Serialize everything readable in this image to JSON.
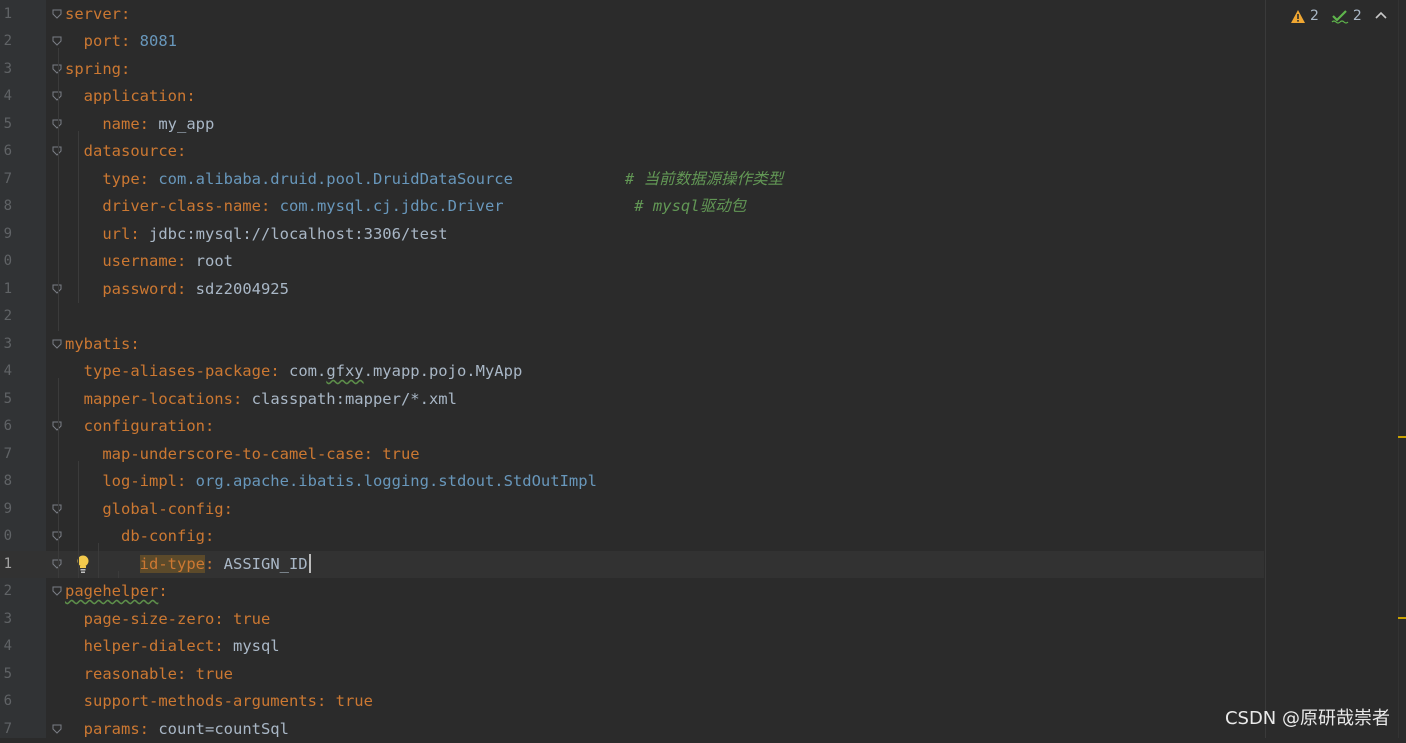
{
  "editor": {
    "lines": [
      {
        "n": "1",
        "tokens": [
          {
            "t": "server",
            "c": "key"
          },
          {
            "t": ":",
            "c": "punct"
          }
        ]
      },
      {
        "n": "2",
        "tokens": [
          {
            "t": "  port",
            "c": "key"
          },
          {
            "t": ": ",
            "c": "punct"
          },
          {
            "t": "8081",
            "c": "vals"
          }
        ]
      },
      {
        "n": "3",
        "tokens": [
          {
            "t": "spring",
            "c": "key"
          },
          {
            "t": ":",
            "c": "punct"
          }
        ]
      },
      {
        "n": "4",
        "tokens": [
          {
            "t": "  application",
            "c": "key"
          },
          {
            "t": ":",
            "c": "punct"
          }
        ]
      },
      {
        "n": "5",
        "tokens": [
          {
            "t": "    name",
            "c": "key"
          },
          {
            "t": ": ",
            "c": "punct"
          },
          {
            "t": "my_app",
            "c": "val"
          }
        ]
      },
      {
        "n": "6",
        "tokens": [
          {
            "t": "  datasource",
            "c": "key"
          },
          {
            "t": ":",
            "c": "punct"
          }
        ]
      },
      {
        "n": "7",
        "tokens": [
          {
            "t": "    type",
            "c": "key"
          },
          {
            "t": ": ",
            "c": "punct"
          },
          {
            "t": "com.alibaba.druid.pool.DruidDataSource",
            "c": "vals"
          },
          {
            "t": "            # 当前数据源操作类型",
            "c": "cmt"
          }
        ]
      },
      {
        "n": "8",
        "tokens": [
          {
            "t": "    driver-class-name",
            "c": "key"
          },
          {
            "t": ": ",
            "c": "punct"
          },
          {
            "t": "com.mysql.cj.jdbc.Driver",
            "c": "vals"
          },
          {
            "t": "              # mysql驱动包",
            "c": "cmt"
          }
        ]
      },
      {
        "n": "9",
        "tokens": [
          {
            "t": "    url",
            "c": "key"
          },
          {
            "t": ": ",
            "c": "punct"
          },
          {
            "t": "jdbc:mysql://localhost:3306/test",
            "c": "val"
          }
        ]
      },
      {
        "n": "0",
        "tokens": [
          {
            "t": "    username",
            "c": "key"
          },
          {
            "t": ": ",
            "c": "punct"
          },
          {
            "t": "root",
            "c": "val"
          }
        ]
      },
      {
        "n": "1",
        "tokens": [
          {
            "t": "    password",
            "c": "key"
          },
          {
            "t": ": ",
            "c": "punct"
          },
          {
            "t": "sdz2004925",
            "c": "val"
          }
        ]
      },
      {
        "n": "2",
        "tokens": []
      },
      {
        "n": "3",
        "tokens": [
          {
            "t": "mybatis",
            "c": "key"
          },
          {
            "t": ":",
            "c": "punct"
          }
        ]
      },
      {
        "n": "4",
        "tokens": [
          {
            "t": "  type-aliases-package",
            "c": "key"
          },
          {
            "t": ": ",
            "c": "punct"
          },
          {
            "t": "com.",
            "c": "val"
          },
          {
            "t": "gfxy",
            "c": "val typo"
          },
          {
            "t": ".myapp.pojo.MyApp",
            "c": "val"
          }
        ]
      },
      {
        "n": "5",
        "tokens": [
          {
            "t": "  mapper-locations",
            "c": "key"
          },
          {
            "t": ": ",
            "c": "punct"
          },
          {
            "t": "classpath:mapper/*.xml",
            "c": "val"
          }
        ]
      },
      {
        "n": "6",
        "tokens": [
          {
            "t": "  configuration",
            "c": "key"
          },
          {
            "t": ":",
            "c": "punct"
          }
        ]
      },
      {
        "n": "7",
        "tokens": [
          {
            "t": "    map-underscore-to-camel-case",
            "c": "key"
          },
          {
            "t": ": ",
            "c": "punct"
          },
          {
            "t": "true",
            "c": "bool"
          }
        ]
      },
      {
        "n": "8",
        "tokens": [
          {
            "t": "    log-impl",
            "c": "key"
          },
          {
            "t": ": ",
            "c": "punct"
          },
          {
            "t": "org.apache.ibatis.logging.stdout.StdOutImpl",
            "c": "vals"
          }
        ]
      },
      {
        "n": "9",
        "tokens": [
          {
            "t": "    global-config",
            "c": "key"
          },
          {
            "t": ":",
            "c": "punct"
          }
        ]
      },
      {
        "n": "0",
        "tokens": [
          {
            "t": "      db-config",
            "c": "key"
          },
          {
            "t": ":",
            "c": "punct"
          }
        ]
      },
      {
        "n": "1",
        "tokens": [
          {
            "t": "        ",
            "c": "val"
          },
          {
            "t": "id-type",
            "c": "key hl-key"
          },
          {
            "t": ": ",
            "c": "punct"
          },
          {
            "t": "ASSIGN_ID",
            "c": "val"
          }
        ],
        "current": true
      },
      {
        "n": "2",
        "tokens": [
          {
            "t": "pagehelper",
            "c": "key typo"
          },
          {
            "t": ":",
            "c": "punct"
          }
        ]
      },
      {
        "n": "3",
        "tokens": [
          {
            "t": "  page-size-zero",
            "c": "key"
          },
          {
            "t": ": ",
            "c": "punct"
          },
          {
            "t": "true",
            "c": "bool"
          }
        ]
      },
      {
        "n": "4",
        "tokens": [
          {
            "t": "  helper-dialect",
            "c": "key"
          },
          {
            "t": ": ",
            "c": "punct"
          },
          {
            "t": "mysql",
            "c": "val"
          }
        ]
      },
      {
        "n": "5",
        "tokens": [
          {
            "t": "  reasonable",
            "c": "key"
          },
          {
            "t": ": ",
            "c": "punct"
          },
          {
            "t": "true",
            "c": "bool"
          }
        ]
      },
      {
        "n": "6",
        "tokens": [
          {
            "t": "  support-methods-arguments",
            "c": "key"
          },
          {
            "t": ": ",
            "c": "punct"
          },
          {
            "t": "true",
            "c": "bool"
          }
        ]
      },
      {
        "n": "7",
        "tokens": [
          {
            "t": "  params",
            "c": "key"
          },
          {
            "t": ": ",
            "c": "punct"
          },
          {
            "t": "count=countSql",
            "c": "val"
          }
        ]
      }
    ]
  },
  "inspection": {
    "warnings": "2",
    "typos": "2",
    "warning_icon": "warning-triangle-icon",
    "typo_icon": "typo-check-icon",
    "nav_icon": "chevron-up-icon"
  },
  "watermark": "CSDN @原研哉崇者",
  "colors": {
    "background": "#2b2b2b",
    "key": "#cc7832",
    "string_value": "#6897bb",
    "comment": "#629755",
    "plain": "#a9b7c6",
    "marker": "#c9a100"
  }
}
